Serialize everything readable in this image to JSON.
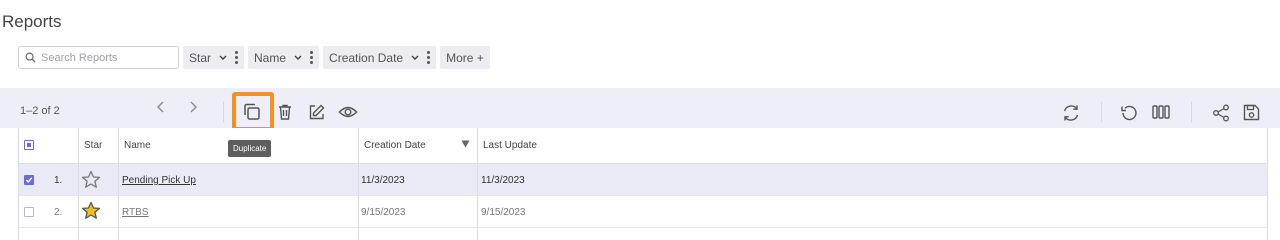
{
  "page": {
    "title": "Reports"
  },
  "search": {
    "placeholder": "Search Reports"
  },
  "filters": [
    {
      "label": "Star"
    },
    {
      "label": "Name"
    },
    {
      "label": "Creation Date"
    }
  ],
  "more_label": "More +",
  "toolbar": {
    "count": "1–2 of 2",
    "tooltip": "Duplicate",
    "accent": "#f7901e"
  },
  "table": {
    "columns": [
      "Star",
      "Name",
      "Creation Date",
      "Last Update"
    ],
    "sort_column": "Creation Date",
    "rows": [
      {
        "index": "1.",
        "starred": false,
        "name": "Pending Pick Up",
        "created": "11/3/2023",
        "updated": "11/3/2023",
        "checked": true
      },
      {
        "index": "2.",
        "starred": true,
        "name": "RTBS",
        "created": "9/15/2023",
        "updated": "9/15/2023",
        "checked": false
      }
    ]
  },
  "colors": {
    "toolbar_bg": "#eeeef8",
    "selected_row": "#eaeaf6",
    "star_fill": "#f2c21b",
    "checkbox": "#6c6cd6"
  }
}
